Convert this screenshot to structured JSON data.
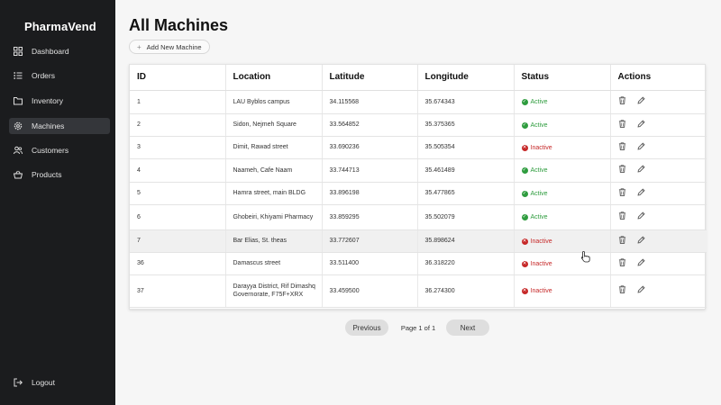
{
  "app": {
    "name": "PharmaVend"
  },
  "sidebar": {
    "items": [
      {
        "label": "Dashboard",
        "icon": "dashboard-icon",
        "active": false
      },
      {
        "label": "Orders",
        "icon": "list-icon",
        "active": false
      },
      {
        "label": "Inventory",
        "icon": "folder-icon",
        "active": false
      },
      {
        "label": "Machines",
        "icon": "gear-icon",
        "active": true
      },
      {
        "label": "Customers",
        "icon": "users-icon",
        "active": false
      },
      {
        "label": "Products",
        "icon": "basket-icon",
        "active": false
      }
    ],
    "logout": {
      "label": "Logout",
      "icon": "logout-icon"
    }
  },
  "page": {
    "title": "All Machines",
    "add_button": "Add New Machine"
  },
  "table": {
    "columns": [
      "ID",
      "Location",
      "Latitude",
      "Longitude",
      "Status",
      "Actions"
    ],
    "rows": [
      {
        "id": "1",
        "location": "LAU Byblos campus",
        "latitude": "34.115568",
        "longitude": "35.674343",
        "status": "Active"
      },
      {
        "id": "2",
        "location": "Sidon, Nejmeh Square",
        "latitude": "33.564852",
        "longitude": "35.375365",
        "status": "Active"
      },
      {
        "id": "3",
        "location": "Dimit, Rawad street",
        "latitude": "33.690236",
        "longitude": "35.505354",
        "status": "Inactive"
      },
      {
        "id": "4",
        "location": "Naameh, Cafe Naam",
        "latitude": "33.744713",
        "longitude": "35.461489",
        "status": "Active"
      },
      {
        "id": "5",
        "location": "Hamra street, main BLDG",
        "latitude": "33.896198",
        "longitude": "35.477865",
        "status": "Active"
      },
      {
        "id": "6",
        "location": "Ghobeiri, Khiyami Pharmacy",
        "latitude": "33.859295",
        "longitude": "35.502079",
        "status": "Active"
      },
      {
        "id": "7",
        "location": "Bar Elias, St. theas",
        "latitude": "33.772607",
        "longitude": "35.898624",
        "status": "Inactive"
      },
      {
        "id": "36",
        "location": "Damascus street",
        "latitude": "33.511400",
        "longitude": "36.318220",
        "status": "Inactive"
      },
      {
        "id": "37",
        "location": "Darayya District, Rif Dimashq Governorate, F75F+XRX",
        "latitude": "33.459500",
        "longitude": "36.274300",
        "status": "Inactive"
      }
    ]
  },
  "pagination": {
    "previous": "Previous",
    "info": "Page 1 of 1",
    "next": "Next"
  },
  "colors": {
    "sidebar_bg": "#1b1c1e",
    "active_status": "#2e9c3e",
    "inactive_status": "#c62828"
  }
}
